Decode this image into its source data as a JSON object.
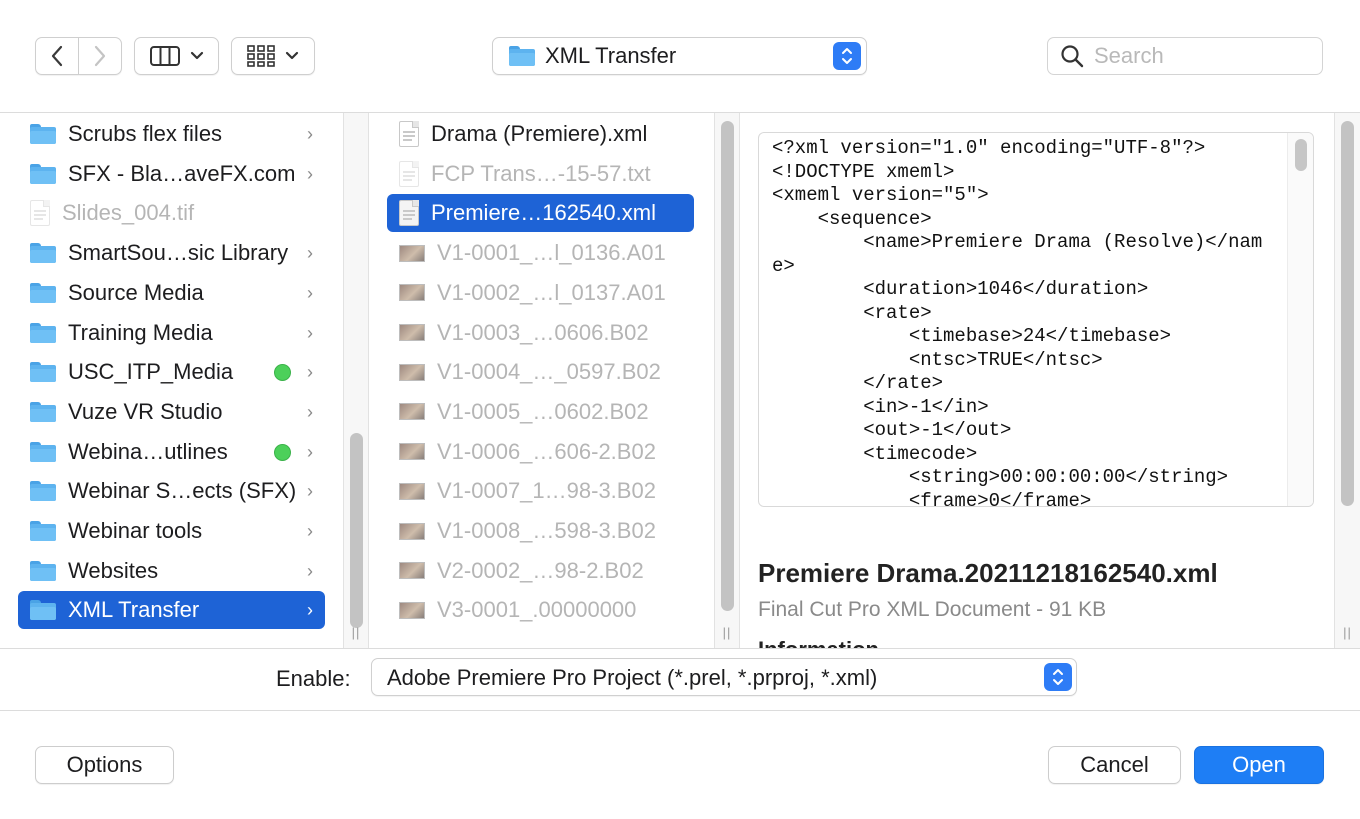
{
  "toolbar": {
    "path_label": "XML Transfer",
    "search_placeholder": "Search"
  },
  "sidebar": {
    "items": [
      {
        "label": "Scrubs flex files",
        "kind": "folder",
        "tag": false,
        "chevron": true,
        "dim": false
      },
      {
        "label": "SFX - Bla…aveFX.com",
        "kind": "folder",
        "tag": false,
        "chevron": true,
        "dim": false
      },
      {
        "label": "Slides_004.tif",
        "kind": "doc",
        "tag": false,
        "chevron": false,
        "dim": true
      },
      {
        "label": "SmartSou…sic Library",
        "kind": "folder",
        "tag": false,
        "chevron": true,
        "dim": false
      },
      {
        "label": "Source Media",
        "kind": "folder",
        "tag": false,
        "chevron": true,
        "dim": false
      },
      {
        "label": "Training Media",
        "kind": "folder",
        "tag": false,
        "chevron": true,
        "dim": false
      },
      {
        "label": "USC_ITP_Media",
        "kind": "folder",
        "tag": true,
        "chevron": true,
        "dim": false
      },
      {
        "label": "Vuze VR Studio",
        "kind": "folder",
        "tag": false,
        "chevron": true,
        "dim": false
      },
      {
        "label": "Webina…utlines",
        "kind": "folder",
        "tag": true,
        "chevron": true,
        "dim": false
      },
      {
        "label": "Webinar S…ects (SFX)",
        "kind": "folder",
        "tag": false,
        "chevron": true,
        "dim": false
      },
      {
        "label": "Webinar tools",
        "kind": "folder",
        "tag": false,
        "chevron": true,
        "dim": false
      },
      {
        "label": "Websites",
        "kind": "folder",
        "tag": false,
        "chevron": true,
        "dim": false
      },
      {
        "label": "XML Transfer",
        "kind": "folder",
        "tag": false,
        "chevron": true,
        "dim": false,
        "selected": true
      }
    ]
  },
  "files": {
    "items": [
      {
        "label": "Drama (Premiere).xml",
        "kind": "doc",
        "dim": false
      },
      {
        "label": "FCP Trans…-15-57.txt",
        "kind": "doc",
        "dim": true
      },
      {
        "label": "Premiere…162540.xml",
        "kind": "doc",
        "dim": false,
        "selected": true
      },
      {
        "label": "V1-0001_…l_0136.A01",
        "kind": "clip",
        "dim": true
      },
      {
        "label": "V1-0002_…l_0137.A01",
        "kind": "clip",
        "dim": true
      },
      {
        "label": "V1-0003_…0606.B02",
        "kind": "clip",
        "dim": true
      },
      {
        "label": "V1-0004_…_0597.B02",
        "kind": "clip",
        "dim": true
      },
      {
        "label": "V1-0005_…0602.B02",
        "kind": "clip",
        "dim": true
      },
      {
        "label": "V1-0006_…606-2.B02",
        "kind": "clip",
        "dim": true
      },
      {
        "label": "V1-0007_1…98-3.B02",
        "kind": "clip",
        "dim": true
      },
      {
        "label": "V1-0008_…598-3.B02",
        "kind": "clip",
        "dim": true
      },
      {
        "label": "V2-0002_…98-2.B02",
        "kind": "clip",
        "dim": true
      },
      {
        "label": "V3-0001_.00000000",
        "kind": "clip",
        "dim": true
      }
    ]
  },
  "preview": {
    "code": "<?xml version=\"1.0\" encoding=\"UTF-8\"?>\n<!DOCTYPE xmeml>\n<xmeml version=\"5\">\n    <sequence>\n        <name>Premiere Drama (Resolve)</name>\n        <duration>1046</duration>\n        <rate>\n            <timebase>24</timebase>\n            <ntsc>TRUE</ntsc>\n        </rate>\n        <in>-1</in>\n        <out>-1</out>\n        <timecode>\n            <string>00:00:00:00</string>\n            <frame>0</frame>",
    "title": "Premiere Drama.20211218162540.xml",
    "subtitle": "Final Cut Pro XML Document - 91 KB",
    "info_heading": "Information"
  },
  "footer": {
    "enable_label": "Enable:",
    "enable_value": "Adobe Premiere Pro Project (*.prel, *.prproj, *.xml)",
    "options_label": "Options",
    "cancel_label": "Cancel",
    "open_label": "Open"
  },
  "colors": {
    "selection": "#1e63d6",
    "accent": "#1e7ef5",
    "tag_green": "#4cd05a"
  }
}
